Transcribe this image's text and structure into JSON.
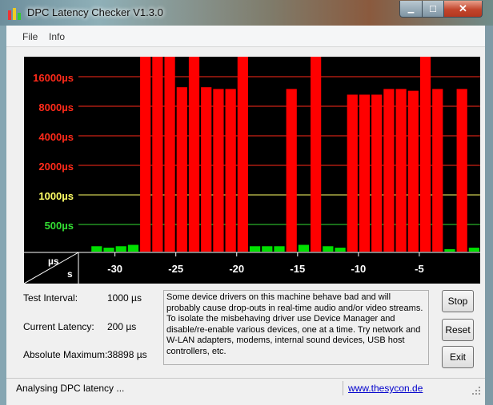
{
  "window": {
    "title": "DPC Latency Checker V1.3.0",
    "minimize_glyph": "▁",
    "maximize_glyph": "☐",
    "close_glyph": "✕"
  },
  "menu": {
    "items": [
      "File",
      "Info"
    ]
  },
  "chart_data": {
    "type": "bar",
    "title": "",
    "xlabel": "s",
    "ylabel": "µs",
    "y_scale": "log",
    "y_ticks": [
      "16000µs",
      "8000µs",
      "4000µs",
      "2000µs",
      "1000µs",
      "500µs"
    ],
    "y_tick_values": [
      16000,
      8000,
      4000,
      2000,
      1000,
      500
    ],
    "y_tick_colors": [
      "#ff2a1a",
      "#ff2a1a",
      "#ff2a1a",
      "#ff2a1a",
      "#ffff66",
      "#33dd33"
    ],
    "x_ticks": [
      "-30",
      "-25",
      "-20",
      "-15",
      "-10",
      "-5"
    ],
    "x_tick_values": [
      -30,
      -25,
      -20,
      -15,
      -10,
      -5
    ],
    "xlim": [
      -33,
      0
    ],
    "thresholds": {
      "green_max": 1000,
      "yellow_max": 2000
    },
    "series": [
      {
        "x": [
          -32,
          -31,
          -30,
          -29,
          -28,
          -27,
          -26,
          -25,
          -24,
          -23,
          -22,
          -21,
          -20,
          -19,
          -18,
          -17,
          -16,
          -15,
          -14,
          -13,
          -12,
          -11,
          -10,
          -9,
          -8,
          -7,
          -6,
          -5,
          -4,
          -3,
          -2,
          -1
        ],
        "values": [
          300,
          290,
          300,
          310,
          40000,
          40000,
          40000,
          12500,
          40000,
          12500,
          12000,
          12000,
          40000,
          300,
          300,
          300,
          12000,
          310,
          40000,
          300,
          290,
          10500,
          10500,
          10500,
          12000,
          12000,
          11500,
          40000,
          12000,
          280,
          12000,
          290
        ]
      }
    ],
    "colors": {
      "green": "#00e000",
      "yellow": "#ffff66",
      "red": "#ff0000",
      "grid": "#cc0000",
      "axis_text": "#ffffff",
      "background": "#000000"
    }
  },
  "info": {
    "test_interval_label": "Test Interval:",
    "test_interval_value": "1000 µs",
    "current_latency_label": "Current Latency:",
    "current_latency_value": "200 µs",
    "absolute_max_label": "Absolute Maximum:",
    "absolute_max_value": "38898 µs"
  },
  "description": "Some device drivers on this machine behave bad and will probably cause drop-outs in real-time audio and/or video streams. To isolate the misbehaving driver use Device Manager and disable/re-enable various devices, one at a time. Try network and W-LAN adapters, modems, internal sound devices, USB host controllers, etc.",
  "buttons": {
    "stop": "Stop",
    "reset": "Reset",
    "exit": "Exit"
  },
  "status": {
    "text": "Analysing DPC latency ...",
    "link": "www.thesycon.de"
  }
}
